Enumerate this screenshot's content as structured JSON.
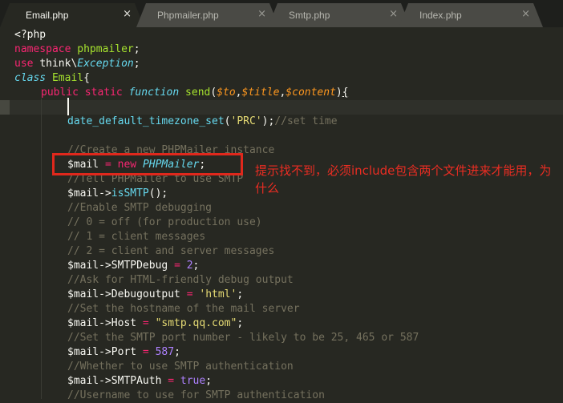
{
  "tabs": [
    {
      "label": "Email.php",
      "close": "×",
      "active": true
    },
    {
      "label": "Phpmailer.php",
      "close": "×",
      "active": false
    },
    {
      "label": "Smtp.php",
      "close": "×",
      "active": false
    },
    {
      "label": "Index.php",
      "close": "×",
      "active": false
    }
  ],
  "code": {
    "l1": "<?php",
    "l2_kw": "namespace",
    "l2_name": "phpmailer",
    "l3_kw": "use",
    "l3_a": "think\\",
    "l3_b": "Exception",
    "l4_kw": "class",
    "l4_name": "Email",
    "l5_public": "public",
    "l5_static": "static",
    "l5_function": "function",
    "l5_name": "send",
    "l5_p1": "$to",
    "l5_p2": "$title",
    "l5_p3": "$content",
    "l7_fn": "date_default_timezone_set",
    "l7_arg": "'PRC'",
    "l7_comment": "//set time",
    "l9_comment": "//Create a new PHPMailer instance",
    "l10_var": "$mail",
    "l10_new": "new",
    "l10_class": "PHPMailer",
    "l11_comment": "//Tell PHPMailer to use SMTP",
    "l12_var": "$mail->",
    "l12_method": "isSMTP",
    "l13_comment": "//Enable SMTP debugging",
    "l14_comment": "// 0 = off (for production use)",
    "l15_comment": "// 1 = client messages",
    "l16_comment": "// 2 = client and server messages",
    "l17_var": "$mail->SMTPDebug",
    "l17_val": "2",
    "l18_comment": "//Ask for HTML-friendly debug output",
    "l19_var": "$mail->Debugoutput",
    "l19_val": "'html'",
    "l20_comment": "//Set the hostname of the mail server",
    "l21_var": "$mail->Host",
    "l21_val": "\"smtp.qq.com\"",
    "l22_comment": "//Set the SMTP port number - likely to be 25, 465 or 587",
    "l23_var": "$mail->Port",
    "l23_val": "587",
    "l24_comment": "//Whether to use SMTP authentication",
    "l25_var": "$mail->SMTPAuth",
    "l25_val": "true",
    "l26_comment": "//Username to use for SMTP authentication"
  },
  "annotation": "提示找不到，必须include包含两个文件进来才能用，为什么",
  "colors": {
    "background": "#272822",
    "keyword": "#f92672",
    "name": "#a6e22e",
    "string": "#e6db74",
    "comment": "#75715e",
    "number": "#ae81ff",
    "type": "#66d9ef",
    "param": "#fd971f",
    "annotation_red": "#e0281c"
  }
}
